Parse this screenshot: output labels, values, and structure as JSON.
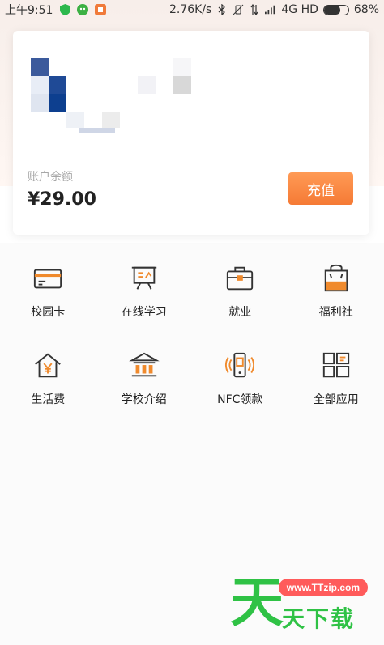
{
  "status_bar": {
    "time": "上午9:51",
    "net_speed": "2.76K/s",
    "network": "4G HD",
    "battery": "68%",
    "battery_level": 0.68
  },
  "card": {
    "balance_label": "账户余额",
    "balance_value": "¥29.00",
    "recharge_label": "充值"
  },
  "grid": {
    "items": [
      {
        "label": "校园卡",
        "icon": "card-icon"
      },
      {
        "label": "在线学习",
        "icon": "presentation-icon"
      },
      {
        "label": "就业",
        "icon": "briefcase-icon"
      },
      {
        "label": "福利社",
        "icon": "shopping-bag-icon"
      },
      {
        "label": "生活费",
        "icon": "house-yen-icon"
      },
      {
        "label": "学校介绍",
        "icon": "school-building-icon"
      },
      {
        "label": "NFC领款",
        "icon": "nfc-phone-icon"
      },
      {
        "label": "全部应用",
        "icon": "all-apps-icon"
      }
    ]
  },
  "watermark": {
    "url": "www.TTzip.com",
    "big_char": "天",
    "small_text": "天下载"
  },
  "colors": {
    "accent": "#f57a35",
    "icon_dark": "#333333",
    "icon_orange": "#f08a2c",
    "watermark_green": "#2fc245"
  }
}
